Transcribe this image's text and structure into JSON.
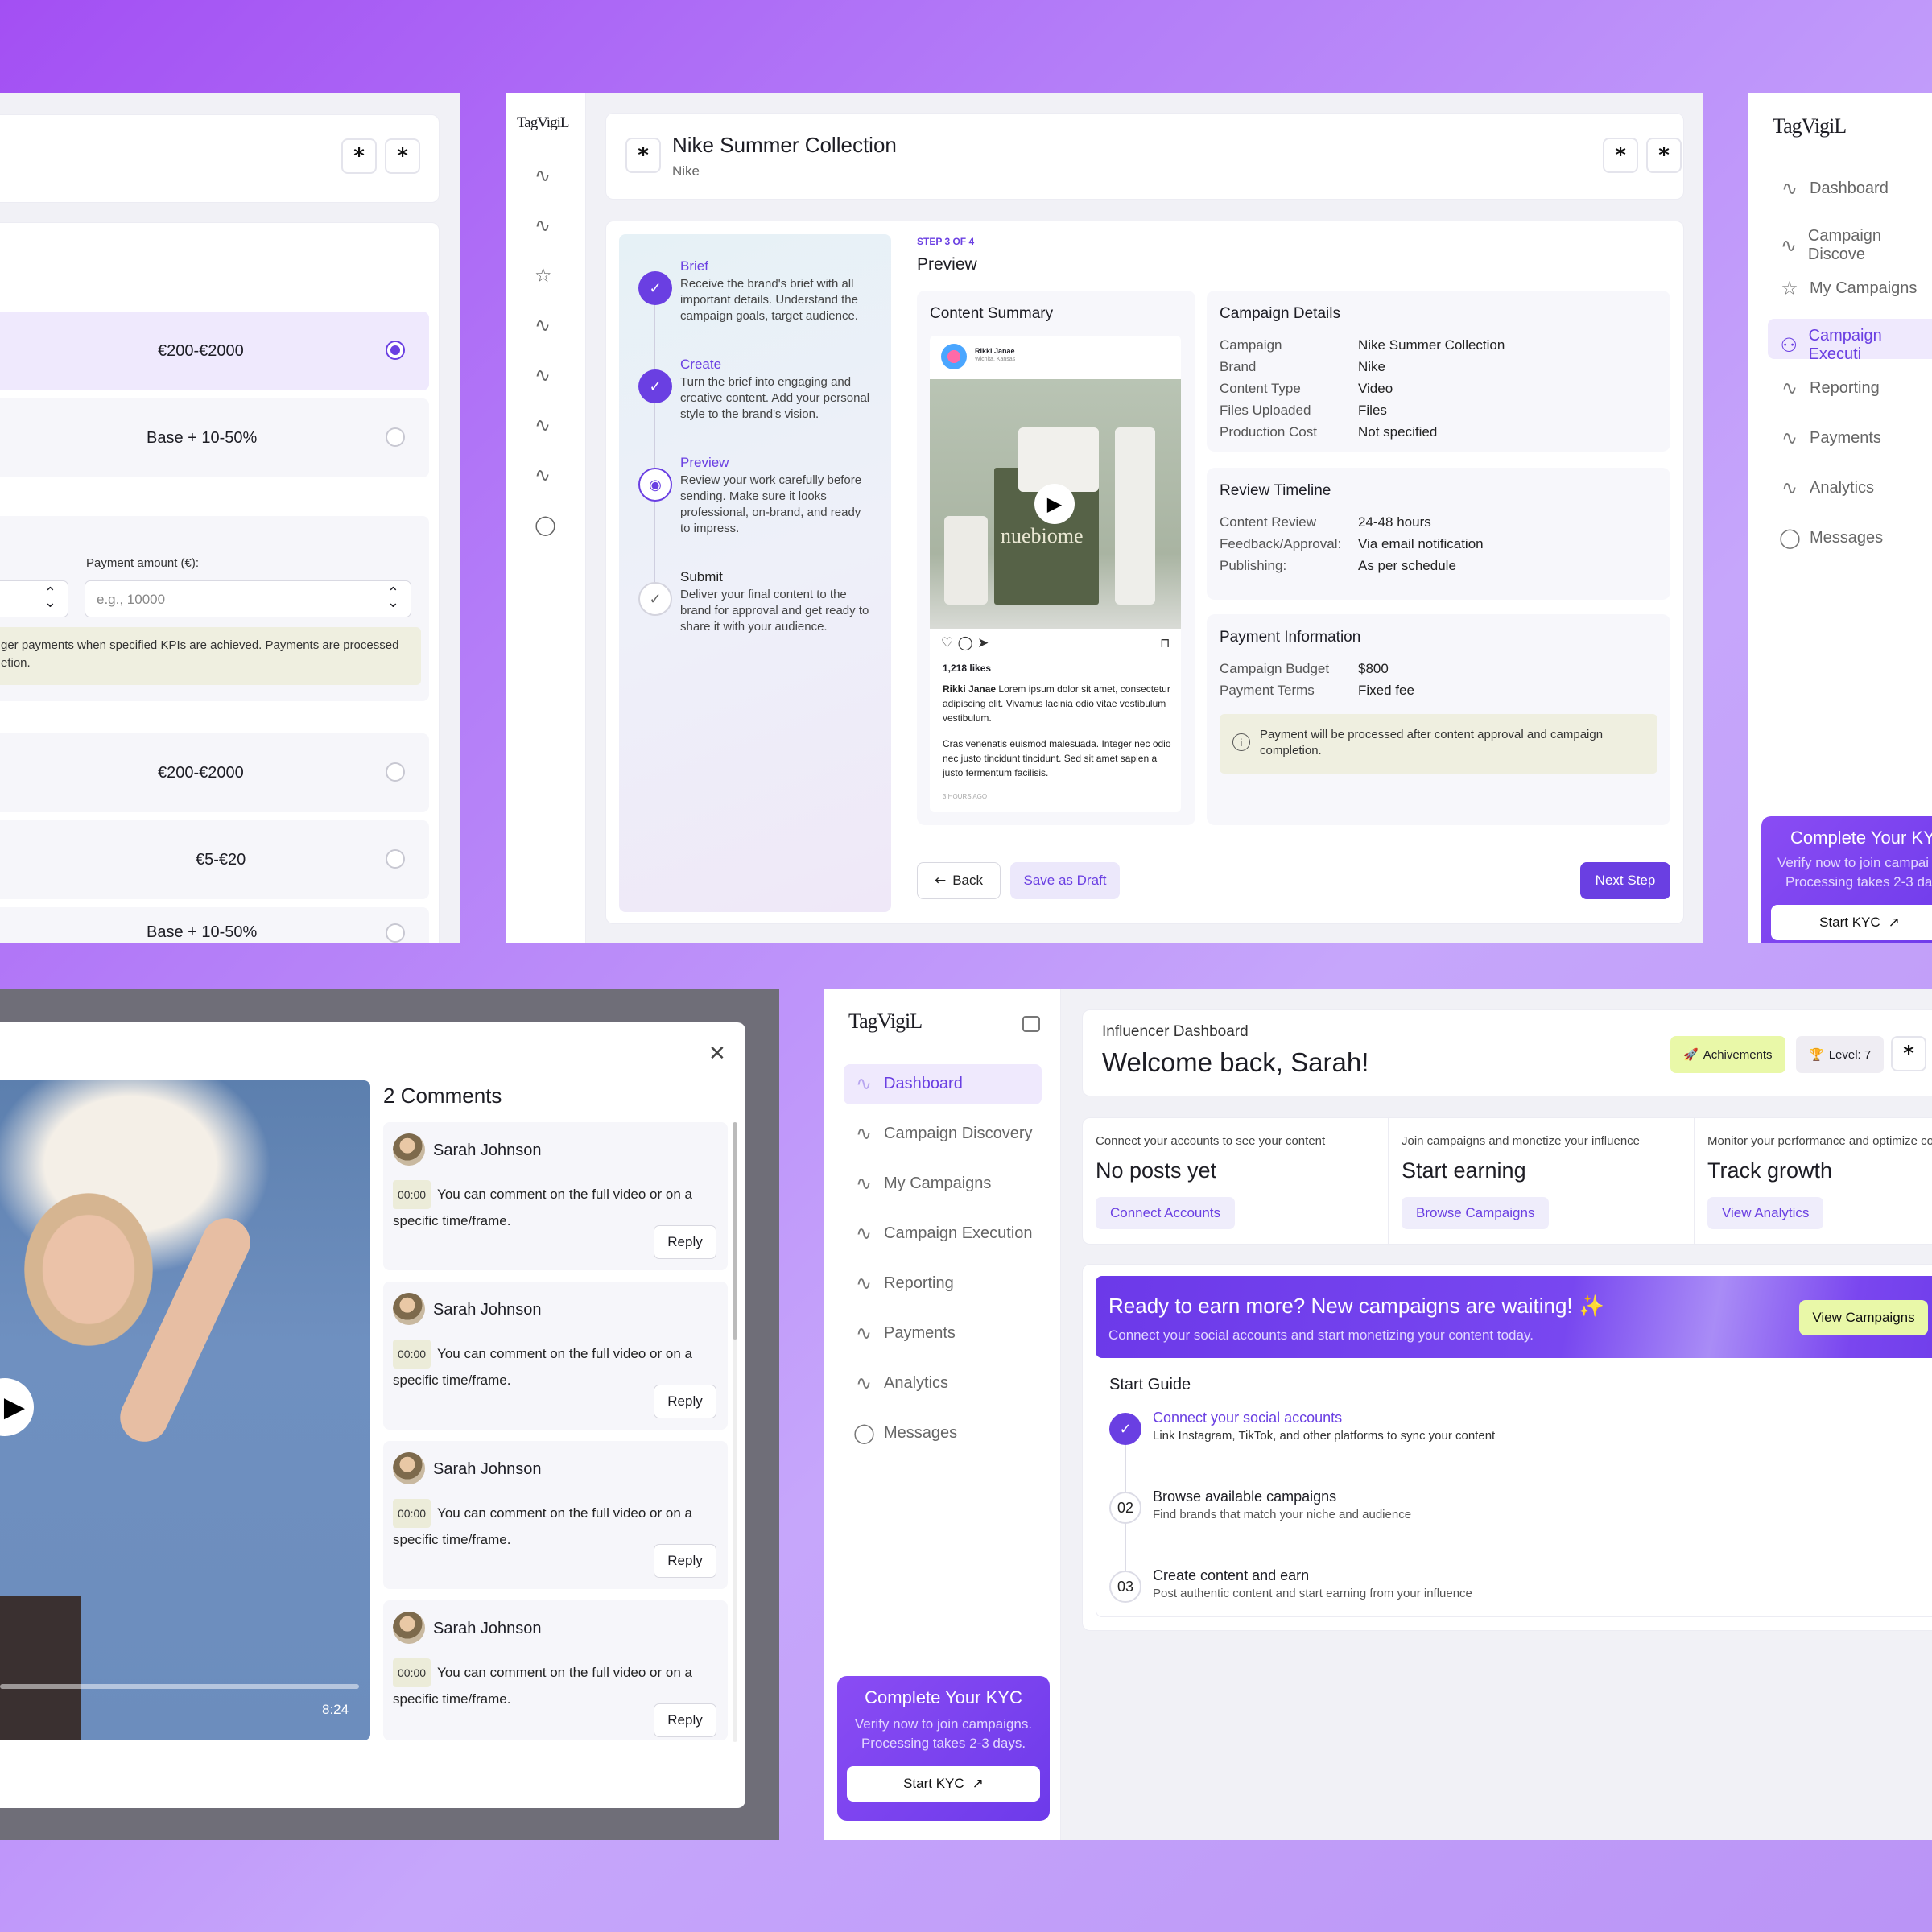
{
  "brand": {
    "logo": "TagVigiL"
  },
  "pricing": {
    "options": [
      {
        "label": "€200-€2000",
        "selected": true
      },
      {
        "label": "Base + 10-50%",
        "selected": false
      },
      {
        "label": "€200-€2000",
        "selected": false
      },
      {
        "label": "€5-€20",
        "selected": false
      },
      {
        "label": "Base + 10-50%",
        "selected": false
      }
    ],
    "payment_amount_label": "Payment amount (€):",
    "payment_amount_placeholder": "e.g., 10000",
    "note": "ger payments when specified KPIs are achieved. Payments are processed",
    "note2": "etion."
  },
  "execution": {
    "title": "Nike Summer Collection",
    "subtitle": "Nike",
    "steps": [
      {
        "name": "Brief",
        "desc": "Receive the brand's brief with all important details. Understand the campaign goals, target audience."
      },
      {
        "name": "Create",
        "desc": "Turn the brief into engaging and creative content. Add your personal style  to the brand's vision."
      },
      {
        "name": "Preview",
        "desc": "Review your work carefully before sending. Make sure it looks professional, on-brand, and ready to impress."
      },
      {
        "name": "Submit",
        "desc": "Deliver your final content to the brand for approval and get ready to share it with your audience."
      }
    ],
    "step_indicator": "STEP 3 OF 4",
    "section_title": "Preview",
    "content_summary": {
      "title": "Content Summary",
      "author": "Rikki Janae",
      "location": "Wichita, Kansas",
      "product_brand": "nuebiome",
      "likes": "1,218 likes",
      "caption_author": "Rikki Janae",
      "caption": "Lorem ipsum dolor sit amet, consectetur adipiscing elit. Vivamus lacinia odio vitae vestibulum vestibulum.",
      "caption2": "Cras venenatis euismod malesuada. Integer nec odio nec justo tincidunt tincidunt. Sed sit amet sapien a justo fermentum facilisis.",
      "time": "3 HOURS AGO"
    },
    "campaign_details": {
      "title": "Campaign Details",
      "rows": [
        {
          "k": "Campaign",
          "v": "Nike Summer Collection"
        },
        {
          "k": "Brand",
          "v": "Nike"
        },
        {
          "k": "Content Type",
          "v": "Video"
        },
        {
          "k": "Files Uploaded",
          "v": "Files"
        },
        {
          "k": "Production Cost",
          "v": "Not specified"
        }
      ]
    },
    "review_timeline": {
      "title": "Review Timeline",
      "rows": [
        {
          "k": "Content Review",
          "v": "24-48 hours"
        },
        {
          "k": "Feedback/Approval:",
          "v": "Via email notification"
        },
        {
          "k": "Publishing:",
          "v": "As per schedule"
        }
      ]
    },
    "payment_info": {
      "title": "Payment Information",
      "rows": [
        {
          "k": "Campaign Budget",
          "v": "$800"
        },
        {
          "k": "Payment Terms",
          "v": "Fixed fee"
        }
      ],
      "note": "Payment will be processed after content approval and campaign completion."
    },
    "back_label": "Back",
    "draft_label": "Save as Draft",
    "next_label": "Next Step"
  },
  "right_nav": {
    "items": [
      "Dashboard",
      "Campaign Discove",
      "My Campaigns",
      "Campaign Executi",
      "Reporting",
      "Payments",
      "Analytics",
      "Messages"
    ],
    "active": 3,
    "kyc_title": "Complete Your KY",
    "kyc_text1": "Verify now to join campai",
    "kyc_text2": "Processing takes 2-3 da",
    "kyc_button": "Start KYC"
  },
  "comments": {
    "heading": "2 Comments",
    "duration": "8:24",
    "items": [
      {
        "name": "Sarah Johnson",
        "time": "00:00",
        "text1": "You can comment on the full video or on a",
        "text2": "specific time/frame.",
        "reply": "Reply"
      },
      {
        "name": "Sarah Johnson",
        "time": "00:00",
        "text1": "You can comment on the full video or on a",
        "text2": "specific time/frame.",
        "reply": "Reply"
      },
      {
        "name": "Sarah Johnson",
        "time": "00:00",
        "text1": "You can comment on the full video or on a",
        "text2": "specific time/frame.",
        "reply": "Reply"
      },
      {
        "name": "Sarah Johnson",
        "time": "00:00",
        "text1": "You can comment on the full video or on a",
        "text2": "specific time/frame.",
        "reply": "Reply"
      }
    ]
  },
  "dashboard": {
    "nav": [
      "Dashboard",
      "Campaign Discovery",
      "My Campaigns",
      "Campaign Execution",
      "Reporting",
      "Payments",
      "Analytics",
      "Messages"
    ],
    "active": 0,
    "kyc_title": "Complete Your KYC",
    "kyc_text1": "Verify now to join campaigns.",
    "kyc_text2": "Processing takes 2-3 days.",
    "kyc_button": "Start KYC",
    "eyebrow": "Influencer Dashboard",
    "welcome": "Welcome back, Sarah!",
    "achievements": "Achivements",
    "level": "Level: 7",
    "cards": [
      {
        "hint": "Connect your accounts to see your content",
        "title": "No posts yet",
        "button": "Connect Accounts"
      },
      {
        "hint": "Join campaigns and monetize your influence",
        "title": "Start earning",
        "button": "Browse Campaigns"
      },
      {
        "hint": "Monitor your performance and optimize co",
        "title": "Track growth",
        "button": "View Analytics"
      }
    ],
    "banner_title": "Ready to earn more? New campaigns are waiting! ✨",
    "banner_sub": "Connect your social accounts and start monetizing your content today.",
    "banner_button": "View Campaigns",
    "guide_title": "Start Guide",
    "guide": [
      {
        "num": "",
        "title": "Connect your social accounts",
        "desc": "Link Instagram, TikTok, and other platforms to sync your content",
        "done": true
      },
      {
        "num": "02",
        "title": "Browse available campaigns",
        "desc": "Find brands that match your niche and audience",
        "done": false
      },
      {
        "num": "03",
        "title": "Create content and earn",
        "desc": "Post authentic content and start earning from your influence",
        "done": false
      }
    ]
  },
  "colors": {
    "accent": "#6a3fe2",
    "banner": "#7442ee",
    "chip_green": "#e9f8a8",
    "note_bg": "#efefe0"
  }
}
